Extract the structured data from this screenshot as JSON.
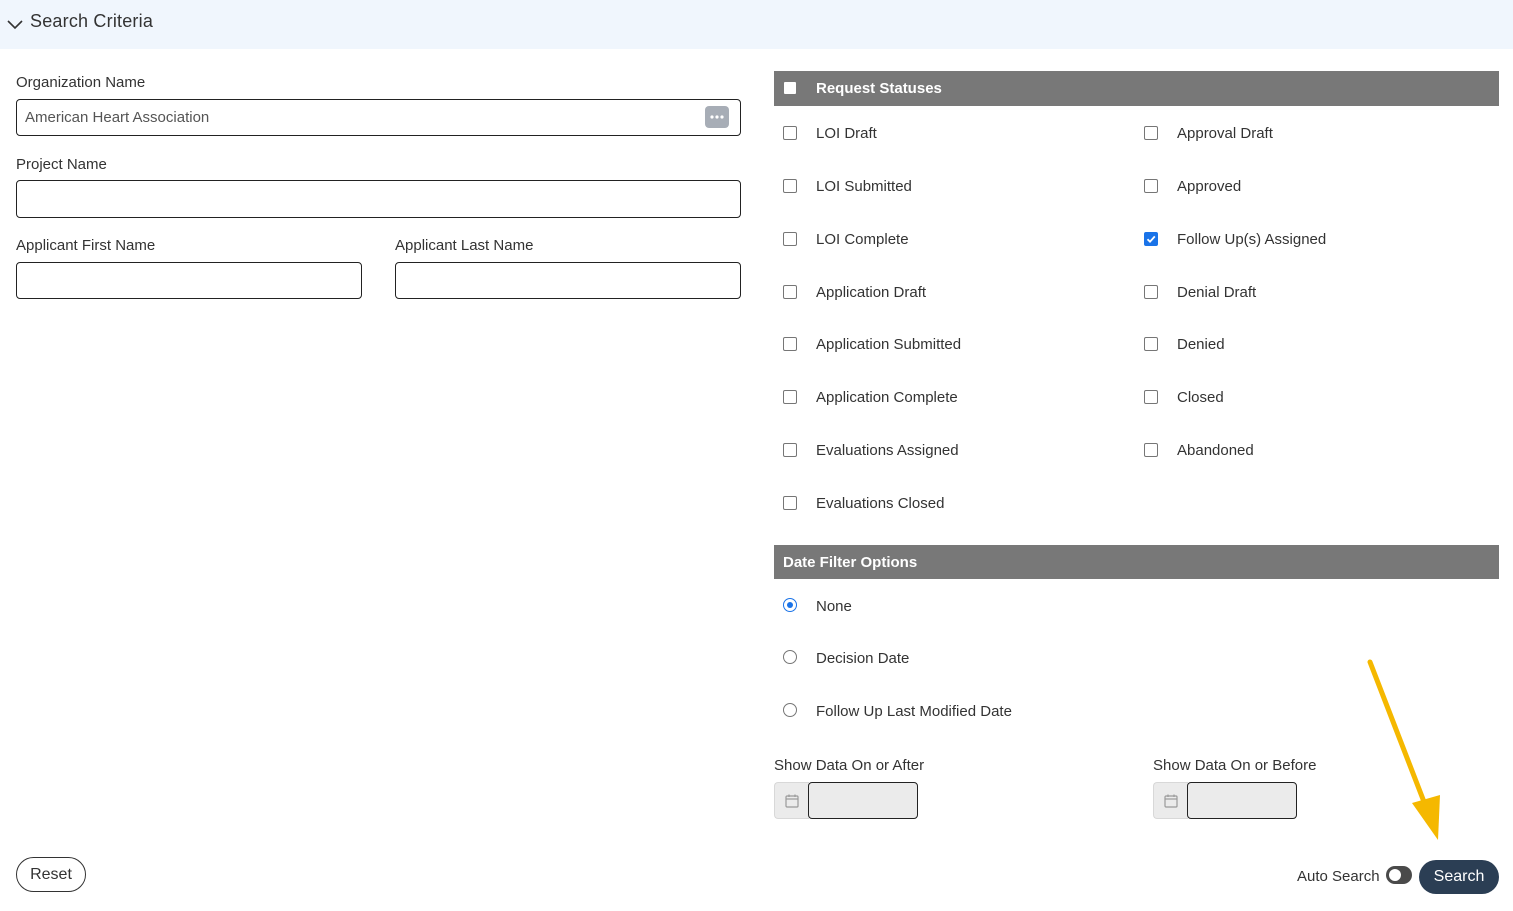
{
  "header": {
    "title": "Search Criteria"
  },
  "form": {
    "org_name": {
      "label": "Organization Name",
      "value": "American Heart Association"
    },
    "project_name": {
      "label": "Project Name",
      "value": ""
    },
    "first_name": {
      "label": "Applicant First Name",
      "value": ""
    },
    "last_name": {
      "label": "Applicant Last Name",
      "value": ""
    }
  },
  "statuses": {
    "title": "Request Statuses",
    "left": [
      {
        "label": "LOI Draft",
        "checked": false
      },
      {
        "label": "LOI Submitted",
        "checked": false
      },
      {
        "label": "LOI Complete",
        "checked": false
      },
      {
        "label": "Application Draft",
        "checked": false
      },
      {
        "label": "Application Submitted",
        "checked": false
      },
      {
        "label": "Application Complete",
        "checked": false
      },
      {
        "label": "Evaluations Assigned",
        "checked": false
      },
      {
        "label": "Evaluations Closed",
        "checked": false
      }
    ],
    "right": [
      {
        "label": "Approval Draft",
        "checked": false
      },
      {
        "label": "Approved",
        "checked": false
      },
      {
        "label": "Follow Up(s) Assigned",
        "checked": true
      },
      {
        "label": "Denial Draft",
        "checked": false
      },
      {
        "label": "Denied",
        "checked": false
      },
      {
        "label": "Closed",
        "checked": false
      },
      {
        "label": "Abandoned",
        "checked": false
      }
    ]
  },
  "date_filter": {
    "title": "Date Filter Options",
    "options": [
      {
        "label": "None",
        "checked": true
      },
      {
        "label": "Decision Date",
        "checked": false
      },
      {
        "label": "Follow Up Last Modified Date",
        "checked": false
      }
    ],
    "after_label": "Show Data On or After",
    "before_label": "Show Data On or Before"
  },
  "footer": {
    "reset_label": "Reset",
    "auto_search_label": "Auto Search",
    "auto_search_on": false,
    "search_label": "Search"
  },
  "colors": {
    "header_bg": "#f0f6fd",
    "bar_bg": "#787878",
    "accent": "#1a73e8",
    "search_btn": "#2b3e54",
    "annotation_arrow": "#f5b800"
  },
  "icons": {
    "collapse": "chevron-down-icon",
    "lookup": "ellipsis-icon",
    "date": "calendar-icon",
    "checked": "checkmark-icon",
    "annotation": "arrow-down-icon"
  }
}
